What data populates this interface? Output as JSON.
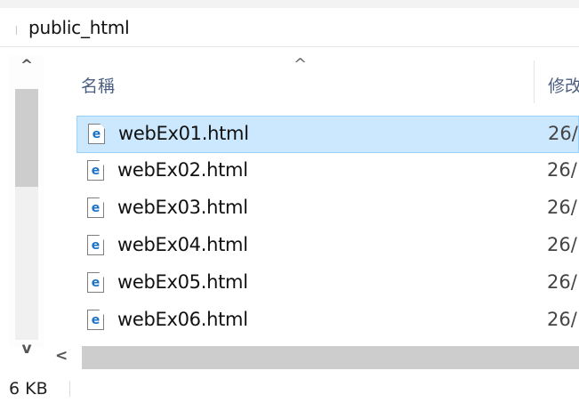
{
  "address": {
    "path": "public_html"
  },
  "vertical_scrollbar": {
    "up_arrow": "^",
    "down_arrow": "v"
  },
  "header": {
    "sort_indicator": "^",
    "name_column": "名稱",
    "modified_column": "修改"
  },
  "files": [
    {
      "name": "webEx01.html",
      "date": "26/",
      "icon": "edge-html-file-icon",
      "selected": true
    },
    {
      "name": "webEx02.html",
      "date": "26/",
      "icon": "edge-html-file-icon",
      "selected": false
    },
    {
      "name": "webEx03.html",
      "date": "26/",
      "icon": "edge-html-file-icon",
      "selected": false
    },
    {
      "name": "webEx04.html",
      "date": "26/",
      "icon": "edge-html-file-icon",
      "selected": false
    },
    {
      "name": "webEx05.html",
      "date": "26/",
      "icon": "edge-html-file-icon",
      "selected": false
    },
    {
      "name": "webEx06.html",
      "date": "26/",
      "icon": "edge-html-file-icon",
      "selected": false
    }
  ],
  "horizontal_scrollbar": {
    "left_arrow": "<"
  },
  "status": {
    "size": "6 KB"
  },
  "colors": {
    "selection_fill": "#cce8ff",
    "selection_border": "#99d1ff",
    "icon_accent": "#1a73c8",
    "header_text": "#4d6082"
  }
}
